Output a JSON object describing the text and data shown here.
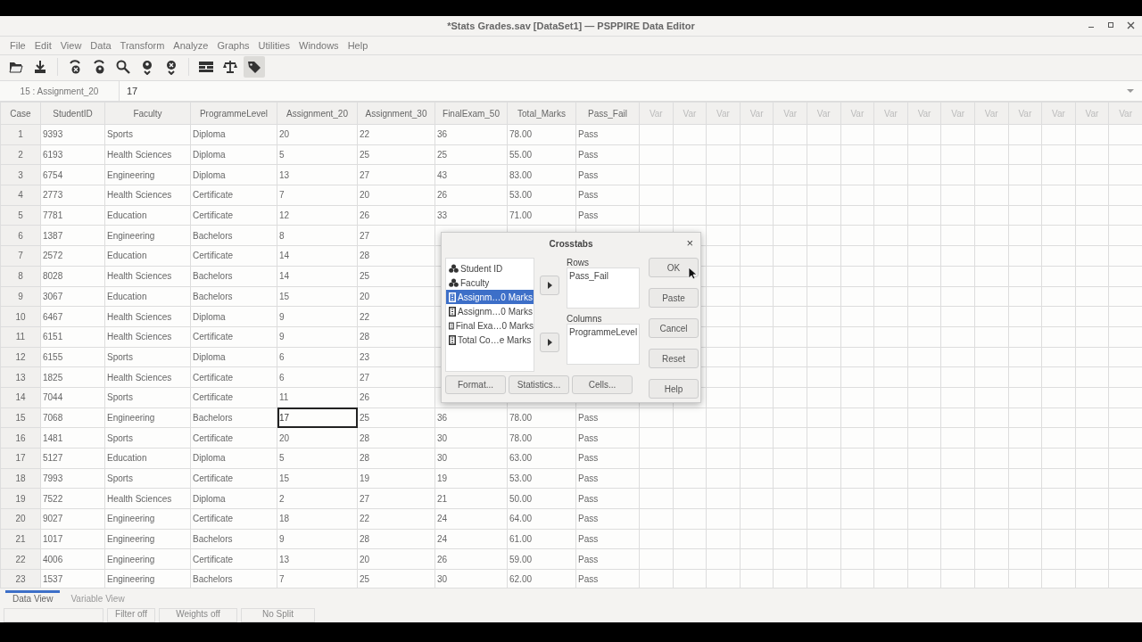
{
  "window": {
    "title": "*Stats Grades.sav [DataSet1] — PSPPIRE Data Editor"
  },
  "menu": [
    "File",
    "Edit",
    "View",
    "Data",
    "Transform",
    "Analyze",
    "Graphs",
    "Utilities",
    "Windows",
    "Help"
  ],
  "toolbar": [
    {
      "kind": "open",
      "pressed": false
    },
    {
      "kind": "save",
      "pressed": false
    },
    {
      "kind": "goto-case",
      "pressed": false
    },
    {
      "kind": "goto-variable",
      "pressed": false
    },
    {
      "kind": "find",
      "pressed": false
    },
    {
      "kind": "insert-case",
      "pressed": false
    },
    {
      "kind": "insert-variable",
      "pressed": false
    },
    {
      "kind": "split",
      "pressed": false
    },
    {
      "kind": "weights",
      "pressed": false
    },
    {
      "kind": "labels",
      "pressed": true
    }
  ],
  "cell_ref": {
    "name": "15 : Assignment_20",
    "value": "17"
  },
  "table": {
    "columns": [
      "Case",
      "StudentID",
      "Faculty",
      "ProgrammeLevel",
      "Assignment_20",
      "Assignment_30",
      "FinalExam_50",
      "Total_Marks",
      "Pass_Fail"
    ],
    "var_columns": [
      "Var",
      "Var",
      "Var",
      "Var",
      "Var",
      "Var",
      "Var",
      "Var",
      "Var",
      "Var",
      "Var",
      "Var",
      "Var",
      "Var",
      "Var"
    ],
    "rows": [
      {
        "cells": [
          "1",
          "9393",
          "Sports",
          "Diploma",
          "20",
          "22",
          "36",
          "78.00",
          "Pass"
        ]
      },
      {
        "cells": [
          "2",
          "6193",
          "Health Sciences",
          "Diploma",
          "5",
          "25",
          "25",
          "55.00",
          "Pass"
        ]
      },
      {
        "cells": [
          "3",
          "6754",
          "Engineering",
          "Diploma",
          "13",
          "27",
          "43",
          "83.00",
          "Pass"
        ]
      },
      {
        "cells": [
          "4",
          "2773",
          "Health Sciences",
          "Certificate",
          "7",
          "20",
          "26",
          "53.00",
          "Pass"
        ]
      },
      {
        "cells": [
          "5",
          "7781",
          "Education",
          "Certificate",
          "12",
          "26",
          "33",
          "71.00",
          "Pass"
        ]
      },
      {
        "cells": [
          "6",
          "1387",
          "Engineering",
          "Bachelors",
          "8",
          "27",
          null,
          null,
          null
        ]
      },
      {
        "cells": [
          "7",
          "2572",
          "Education",
          "Certificate",
          "14",
          "28",
          null,
          null,
          null
        ]
      },
      {
        "cells": [
          "8",
          "8028",
          "Health Sciences",
          "Bachelors",
          "14",
          "25",
          null,
          null,
          null
        ]
      },
      {
        "cells": [
          "9",
          "3067",
          "Education",
          "Bachelors",
          "15",
          "20",
          null,
          null,
          null
        ]
      },
      {
        "cells": [
          "10",
          "6467",
          "Health Sciences",
          "Diploma",
          "9",
          "22",
          null,
          null,
          null
        ]
      },
      {
        "cells": [
          "11",
          "6151",
          "Health Sciences",
          "Certificate",
          "9",
          "28",
          null,
          null,
          null
        ]
      },
      {
        "cells": [
          "12",
          "6155",
          "Sports",
          "Diploma",
          "6",
          "23",
          null,
          null,
          null
        ]
      },
      {
        "cells": [
          "13",
          "1825",
          "Health Sciences",
          "Certificate",
          "6",
          "27",
          null,
          null,
          null
        ]
      },
      {
        "cells": [
          "14",
          "7044",
          "Sports",
          "Certificate",
          "11",
          "26",
          null,
          null,
          null
        ]
      },
      {
        "cells": [
          "15",
          "7068",
          "Engineering",
          "Bachelors",
          {
            "text": "17",
            "selected": true
          },
          "25",
          "36",
          "78.00",
          "Pass"
        ]
      },
      {
        "cells": [
          "16",
          "1481",
          "Sports",
          "Certificate",
          "20",
          "28",
          "30",
          "78.00",
          "Pass"
        ]
      },
      {
        "cells": [
          "17",
          "5127",
          "Education",
          "Diploma",
          "5",
          "28",
          "30",
          "63.00",
          "Pass"
        ]
      },
      {
        "cells": [
          "18",
          "7993",
          "Sports",
          "Certificate",
          "15",
          "19",
          "19",
          "53.00",
          "Pass"
        ]
      },
      {
        "cells": [
          "19",
          "7522",
          "Health Sciences",
          "Diploma",
          "2",
          "27",
          "21",
          "50.00",
          "Pass"
        ]
      },
      {
        "cells": [
          "20",
          "9027",
          "Engineering",
          "Certificate",
          "18",
          "22",
          "24",
          "64.00",
          "Pass"
        ]
      },
      {
        "cells": [
          "21",
          "1017",
          "Engineering",
          "Bachelors",
          "9",
          "28",
          "24",
          "61.00",
          "Pass"
        ]
      },
      {
        "cells": [
          "22",
          "4006",
          "Engineering",
          "Certificate",
          "13",
          "20",
          "26",
          "59.00",
          "Pass"
        ]
      },
      {
        "cells": [
          "23",
          "1537",
          "Engineering",
          "Bachelors",
          "7",
          "25",
          "30",
          "62.00",
          "Pass"
        ]
      }
    ]
  },
  "dialog": {
    "title": "Crosstabs",
    "close": "×",
    "variables": [
      {
        "label": "Student ID",
        "kind": "nominal",
        "selected": false
      },
      {
        "label": "Faculty",
        "kind": "nominal",
        "selected": false
      },
      {
        "label": "Assignm…0 Marks",
        "kind": "scale",
        "selected": true
      },
      {
        "label": "Assignm…0 Marks",
        "kind": "scale",
        "selected": false
      },
      {
        "label": "Final Exa…0 Marks",
        "kind": "scale",
        "selected": false
      },
      {
        "label": "Total Co…e Marks",
        "kind": "scale",
        "selected": false
      }
    ],
    "rows_label": "Rows",
    "rows": [
      "Pass_Fail"
    ],
    "columns_label": "Columns",
    "columns": [
      "ProgrammeLevel"
    ],
    "side_buttons": [
      "OK",
      "Paste",
      "Cancel",
      "Reset",
      "Help"
    ],
    "bottom_buttons": [
      "Format...",
      "Statistics...",
      "Cells..."
    ]
  },
  "tabs": [
    {
      "label": "Data View",
      "selected": true
    },
    {
      "label": "Variable View",
      "selected": false
    }
  ],
  "status_bar": [
    "Filter off",
    "Weights off",
    "No Split"
  ]
}
